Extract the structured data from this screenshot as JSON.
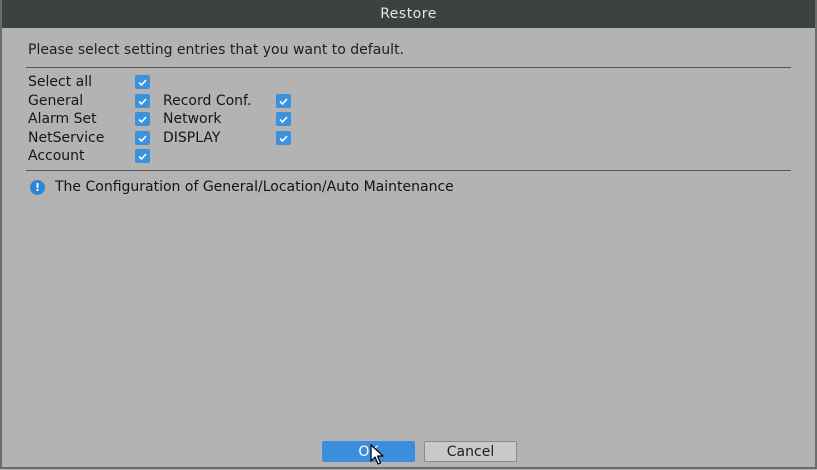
{
  "window": {
    "title": "Restore"
  },
  "prompt": "Please select setting entries that you want to default.",
  "entries": {
    "select_all": {
      "label": "Select all",
      "checked": true
    },
    "general": {
      "label": "General",
      "checked": true
    },
    "record_conf": {
      "label": "Record Conf.",
      "checked": true
    },
    "alarm_set": {
      "label": "Alarm Set",
      "checked": true
    },
    "network": {
      "label": "Network",
      "checked": true
    },
    "netservice": {
      "label": "NetService",
      "checked": true
    },
    "display": {
      "label": "DISPLAY",
      "checked": true
    },
    "account": {
      "label": "Account",
      "checked": true
    }
  },
  "info": {
    "icon": "info-icon",
    "text": "The Configuration of General/Location/Auto Maintenance"
  },
  "buttons": {
    "ok": "OK",
    "cancel": "Cancel"
  },
  "colors": {
    "accent": "#3a8edb",
    "titlebar": "#3e4141",
    "background": "#b2b3b2"
  }
}
